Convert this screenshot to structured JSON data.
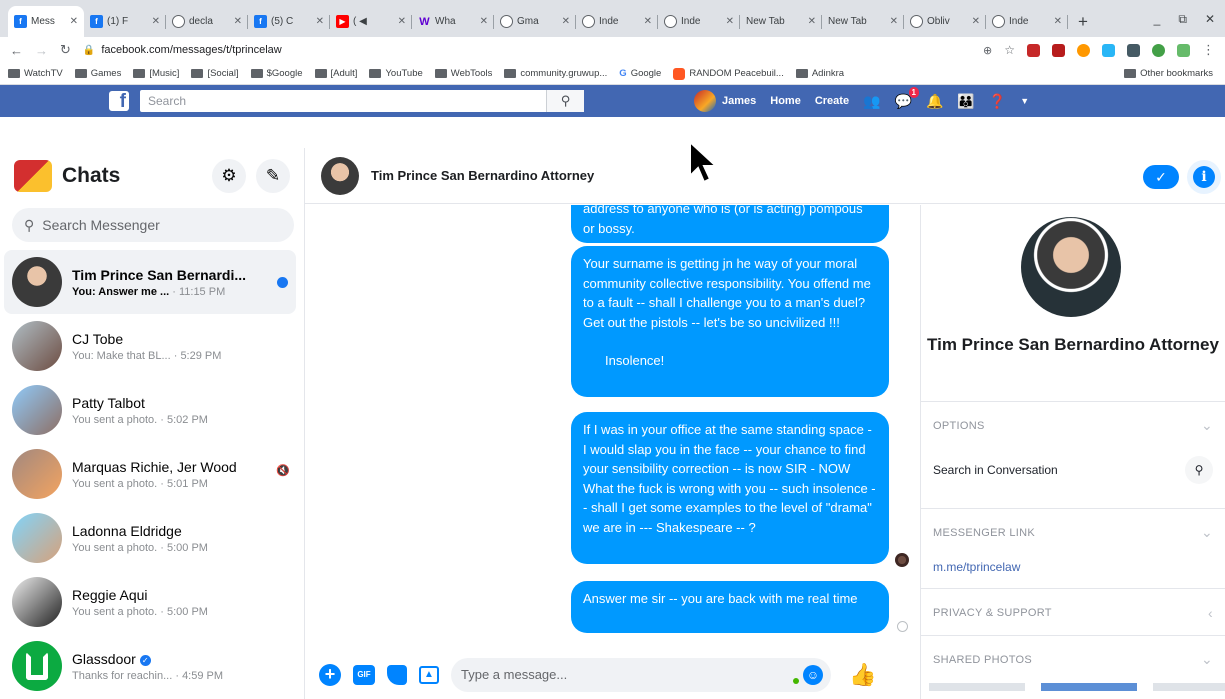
{
  "browser": {
    "tabs": [
      {
        "label": "Mess",
        "icon": "facebook-icon",
        "active": true
      },
      {
        "label": "(1) F",
        "icon": "facebook-icon"
      },
      {
        "label": "decla",
        "icon": "globe-icon"
      },
      {
        "label": "(5) C",
        "icon": "facebook-icon"
      },
      {
        "label": "( ◀",
        "icon": "youtube-icon"
      },
      {
        "label": "Wha",
        "icon": "w-icon"
      },
      {
        "label": "Gma",
        "icon": "globe-icon"
      },
      {
        "label": "Inde",
        "icon": "globe-icon"
      },
      {
        "label": "Inde",
        "icon": "globe-icon"
      },
      {
        "label": "New Tab",
        "icon": "none"
      },
      {
        "label": "New Tab",
        "icon": "none"
      },
      {
        "label": "Obliv",
        "icon": "globe-icon"
      },
      {
        "label": "Inde",
        "icon": "globe-icon"
      }
    ],
    "new_tab": "+",
    "url": "facebook.com/messages/t/tprincelaw",
    "bookmarks": [
      "WatchTV",
      "Games",
      "[Music]",
      "[Social]",
      "$Google",
      "[Adult]",
      "YouTube",
      "WebTools",
      "community.gruwup...",
      "Google",
      "RANDOM Peacebuil...",
      "Adinkra"
    ],
    "other_bookmarks": "Other bookmarks"
  },
  "fb": {
    "search_placeholder": "Search",
    "user": "James",
    "home": "Home",
    "create": "Create",
    "messages_badge": "1"
  },
  "chats": {
    "title": "Chats",
    "search_placeholder": "Search Messenger",
    "items": [
      {
        "name": "Tim Prince San Bernardi...",
        "preview": "You: Answer me ...",
        "time": "· 11:15 PM",
        "unread": true
      },
      {
        "name": "CJ Tobe",
        "preview": "You: Make that BL...",
        "time": "· 5:29 PM"
      },
      {
        "name": "Patty Talbot",
        "preview": "You sent a photo. · 5:02 PM",
        "time": ""
      },
      {
        "name": "Marquas Richie, Jer Wood",
        "preview": "You sent a photo. · 5:01 PM",
        "time": ""
      },
      {
        "name": "Ladonna Eldridge",
        "preview": "You sent a photo. · 5:00 PM",
        "time": ""
      },
      {
        "name": "Reggie Aqui",
        "preview": "You sent a photo. · 5:00 PM",
        "time": ""
      },
      {
        "name": "Glassdoor",
        "preview": "Thanks for reachin...",
        "time": "· 4:59 PM",
        "verified": true
      }
    ]
  },
  "conversation": {
    "name": "Tim Prince San Bernardino Attorney",
    "messages": [
      {
        "text": "address to anyone who is (or is acting) pompous or bossy."
      },
      {
        "text": "Your surname is getting jn he way of your moral community collective responsibility. You offend me to a fault -- shall I challenge you to a man's duel?  Get out the pistols -- let's be so uncivilized  !!!",
        "text2": "Insolence!"
      },
      {
        "text": "If I was in your office at the same standing space - I would slap you in the face -- your chance to find your sensibility correction -- is now SIR - NOW   What the fuck is wrong with you -- such insolence -- shall I get some examples to the level of \"drama\" we are in --- Shakespeare -- ?"
      },
      {
        "text": "Answer me sir -- you are back with me real time"
      }
    ],
    "composer_placeholder": "Type a message..."
  },
  "details": {
    "name": "Tim Prince San Bernardino Attorney",
    "options_title": "OPTIONS",
    "search_in_conversation": "Search in Conversation",
    "messenger_link_title": "MESSENGER LINK",
    "messenger_link": "m.me/tprincelaw",
    "privacy_title": "PRIVACY & SUPPORT",
    "shared_photos_title": "SHARED PHOTOS"
  },
  "colors": {
    "fb_blue": "#4267b2",
    "messenger_blue": "#0099ff",
    "unread_dot": "#1877f2"
  }
}
